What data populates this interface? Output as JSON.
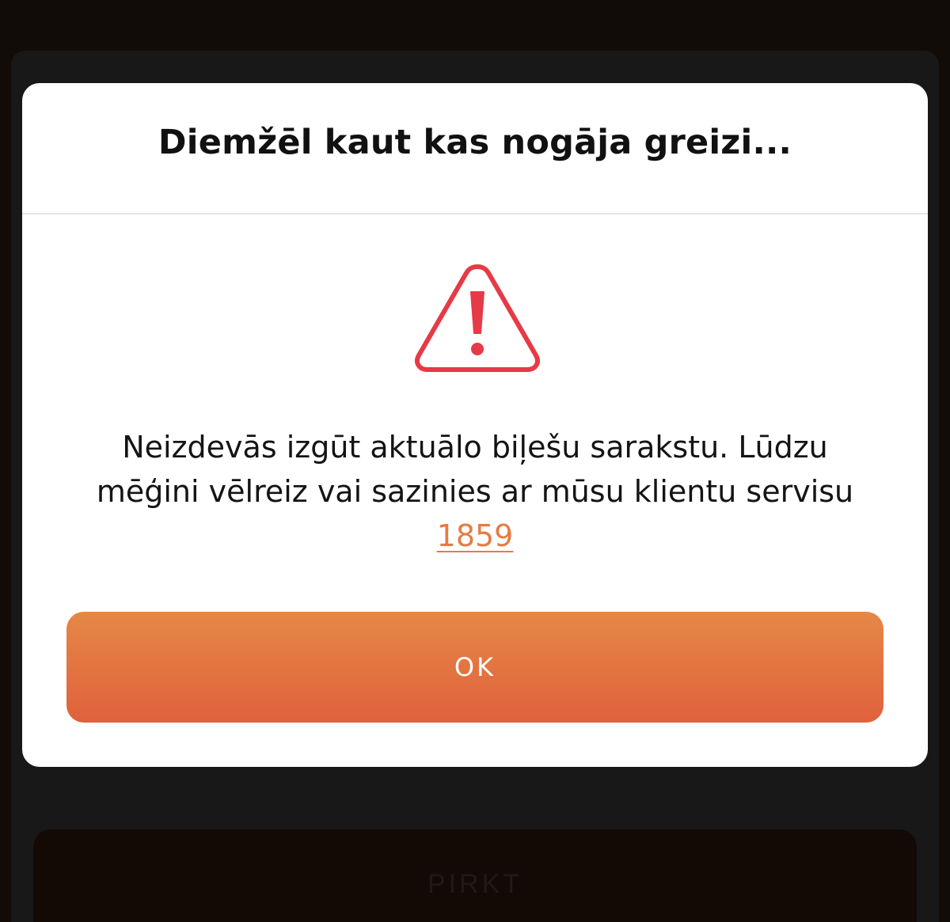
{
  "background": {
    "buy_button_label": "PIRKT"
  },
  "dialog": {
    "title": "Diemžēl kaut kas nogāja greizi...",
    "icon": "warning-triangle-icon",
    "message_line1": "Neizdevās izgūt aktuālo biļešu sarakstu. Lūdzu",
    "message_line2": "mēģini vēlreiz vai sazinies ar mūsu klientu servisu",
    "phone_number": "1859",
    "ok_label": "OK"
  },
  "colors": {
    "accent_start": "#e58846",
    "accent_end": "#e0613c",
    "link": "#e67c43",
    "warning": "#e63a46"
  }
}
